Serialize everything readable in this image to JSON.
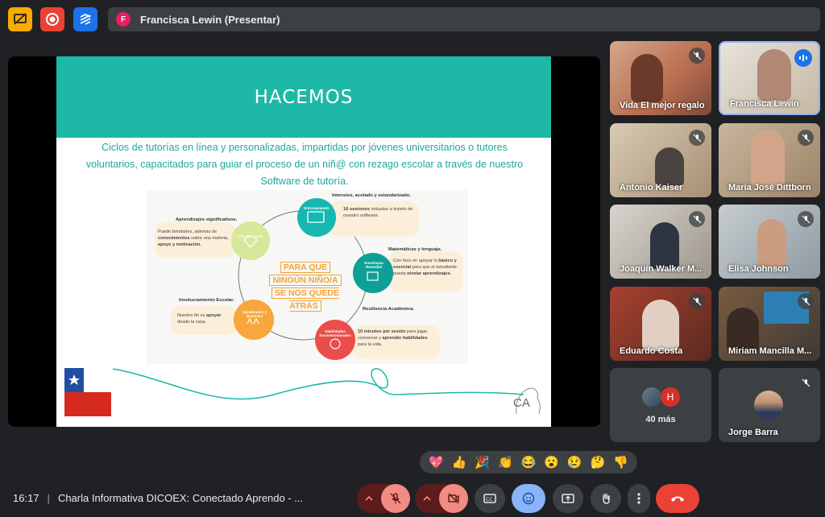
{
  "presenter": {
    "initial": "F",
    "label": "Francisca Lewin (Presentar)"
  },
  "slide": {
    "title": "HACEMOS",
    "text": "Ciclos de tutorías en línea y personalizadas, impartidas por jóvenes universitarios o tutores voluntarios,  capacitados para guiar el proceso de un niñ@ con rezago escolar a través de nuestro Software de tutoría.",
    "center_slogan": [
      "PARA QUE",
      "NINGÚN NIÑO/A",
      "SE NOS QUEDE ATRÁS"
    ],
    "nodes": {
      "entrenamiento": {
        "title": "Entrenamiento",
        "heading": "Intensivo, acotado y estandarizado.",
        "body_bold": "16 sesiones",
        "body": " virtuales a través de nuestro software."
      },
      "vinculo": {
        "title": "Vínculo - Tutor",
        "heading": "Aprendizajes significativos.",
        "body1": "Puede brindarles, además de ",
        "body_bold": "conocimientos",
        "body2": " sobre una materia, ",
        "body_bold2": "apoyo y motivación."
      },
      "ensenanza": {
        "title": "Enseñanza Remedial",
        "heading": "Matemáticas y lenguaje.",
        "body1": "Con foco en apoyar lo ",
        "body_bold": "básico y esencial",
        "body2": " para que el estudiante pueda ",
        "body_bold2": "nivelar aprendizajes."
      },
      "apoderados": {
        "title": "Apoderados y Docentes",
        "heading": "Involucramiento Escolar.",
        "body1": "Nuestro fin es ",
        "body_bold": "apoyar",
        "body2": " desde la casa."
      },
      "habilidades": {
        "title": "Habilidades Socioemocionales",
        "heading": "Resiliencia Académica.",
        "body_bold": "10 minutos por sesión",
        "body1": " para jugar, conversar y ",
        "body_bold2": "aprender habilidades",
        "body2": " para la vida."
      }
    },
    "logo_text": "CA"
  },
  "participants": [
    {
      "name": "Vida El mejor regalo",
      "muted": true
    },
    {
      "name": "Francisca Lewin",
      "muted": false,
      "speaking": true
    },
    {
      "name": "Antonio Kaiser",
      "muted": true
    },
    {
      "name": "María José Dittborn",
      "muted": true
    },
    {
      "name": "Joaquín Walker M...",
      "muted": true
    },
    {
      "name": "Elisa Johnson",
      "muted": true
    },
    {
      "name": "Eduardo Costa",
      "muted": true
    },
    {
      "name": "Miriam Mancilla M...",
      "muted": true
    },
    {
      "name": "40 más",
      "extra_initial": "H"
    },
    {
      "name": "Jorge Barra",
      "muted": true
    }
  ],
  "reactions": [
    "💖",
    "👍",
    "🎉",
    "👏",
    "😂",
    "😮",
    "😢",
    "🤔",
    "👎"
  ],
  "meeting": {
    "time": "16:17",
    "title": "Charla Informativa DICOEX: Conectado Aprendo - ..."
  },
  "colors": {
    "accent": "#1eb8a6",
    "end_call": "#ea4335",
    "mic_off": "#f28b82",
    "active_blue": "#8ab4f8"
  }
}
